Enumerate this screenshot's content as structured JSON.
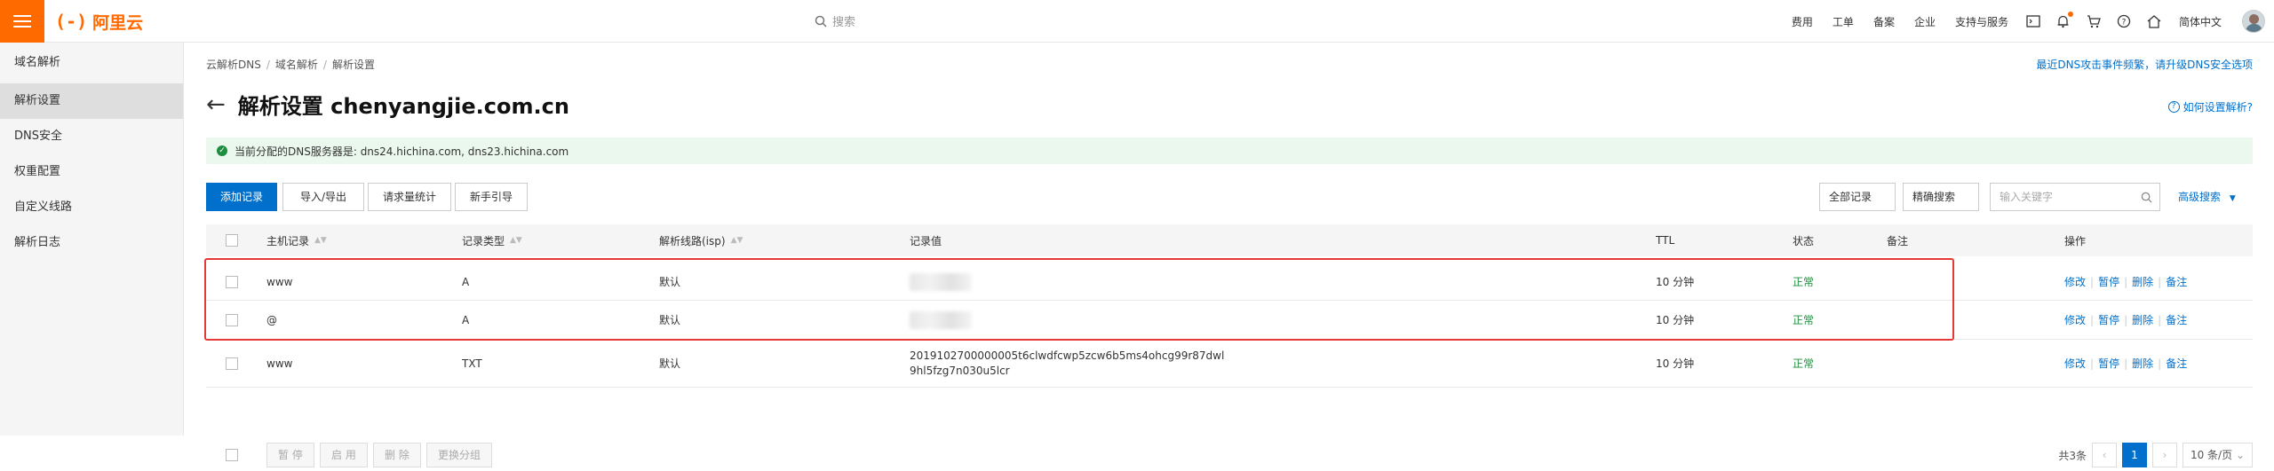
{
  "header": {
    "logo_mark": "(-)",
    "logo_text": "阿里云",
    "search_placeholder": "搜索",
    "links": [
      "费用",
      "工单",
      "备案",
      "企业",
      "支持与服务"
    ],
    "language": "简体中文",
    "icons": [
      "terminal-icon",
      "bell-icon",
      "cart-icon",
      "help-icon",
      "home-icon"
    ],
    "accent": "#ff6a00"
  },
  "sidebar": {
    "items": [
      {
        "label": "域名解析",
        "active": false
      },
      {
        "label": "解析设置",
        "active": true
      },
      {
        "label": "DNS安全",
        "active": false
      },
      {
        "label": "权重配置",
        "active": false
      },
      {
        "label": "自定义线路",
        "active": false
      },
      {
        "label": "解析日志",
        "active": false
      }
    ]
  },
  "breadcrumb": [
    "云解析DNS",
    "域名解析",
    "解析设置"
  ],
  "notice": "最近DNS攻击事件频繁，请升级DNS安全选项",
  "title": "解析设置 chenyangjie.com.cn",
  "help_link": "如何设置解析?",
  "alert": "当前分配的DNS服务器是: dns24.hichina.com, dns23.hichina.com",
  "toolbar": {
    "add": "添加记录",
    "import_export": "导入/导出",
    "stats": "请求量统计",
    "guide": "新手引导",
    "filter_all": "全部记录",
    "exact": "精确搜索",
    "search_placeholder": "输入关键字",
    "advanced": "高级搜索"
  },
  "table": {
    "headers": {
      "host": "主机记录",
      "type": "记录类型",
      "line": "解析线路(isp)",
      "value": "记录值",
      "ttl": "TTL",
      "status": "状态",
      "remark": "备注",
      "ops": "操作"
    },
    "rows": [
      {
        "host": "www",
        "type": "A",
        "line": "默认",
        "value": "",
        "value_blurred": true,
        "ttl": "10 分钟",
        "status": "正常"
      },
      {
        "host": "@",
        "type": "A",
        "line": "默认",
        "value": "",
        "value_blurred": true,
        "ttl": "10 分钟",
        "status": "正常"
      },
      {
        "host": "www",
        "type": "TXT",
        "line": "默认",
        "value_line1": "2019102700000005t6clwdfcwp5zcw6b5ms4ohcg99r87dwl",
        "value_line2": "9hl5fzg7n030u5lcr",
        "value_blurred": false,
        "ttl": "10 分钟",
        "status": "正常"
      }
    ],
    "ops": [
      "修改",
      "暂停",
      "删除",
      "备注"
    ]
  },
  "footer": {
    "batch": [
      "暂 停",
      "启 用",
      "删 除",
      "更换分组"
    ],
    "total": "共3条",
    "page": "1",
    "page_size": "10 条/页"
  }
}
